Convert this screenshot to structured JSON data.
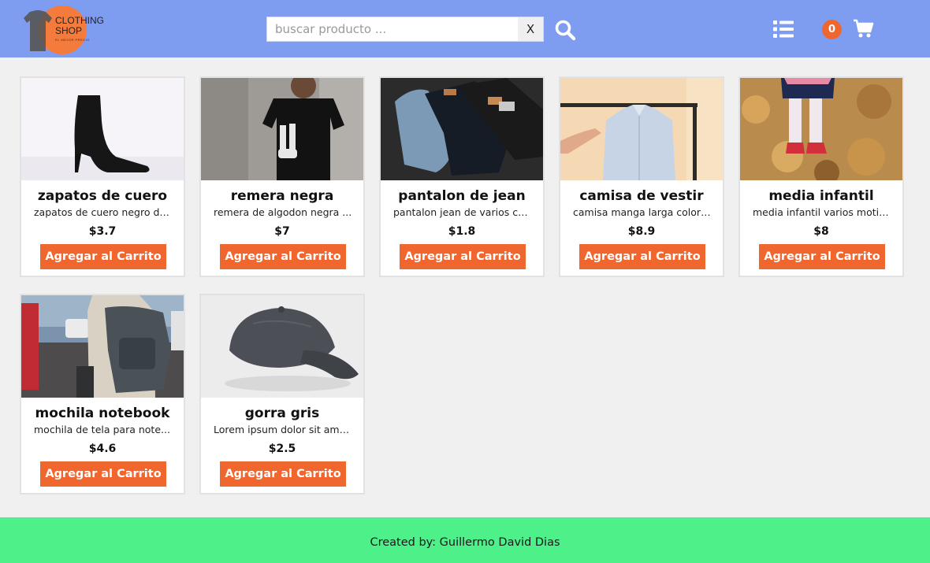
{
  "logo": {
    "line1": "CLOTHING",
    "line2": "SHOP",
    "tagline": "EL MEJOR PRECIO",
    "accent": "#f47b3b"
  },
  "search": {
    "placeholder": "buscar producto ...",
    "value": "",
    "clear_label": "X",
    "icon": "search-icon"
  },
  "nav": {
    "list_icon": "list-icon",
    "cart_icon": "cart-icon",
    "cart_count": "0"
  },
  "colors": {
    "header": "#7f9df0",
    "button": "#f0662f",
    "footer": "#4ef08a",
    "background": "#f0f0f0"
  },
  "products": [
    {
      "name": "zapatos de cuero",
      "desc": "zapatos de cuero negro de...",
      "price": "$3.7",
      "button": "Agregar al Carrito"
    },
    {
      "name": "remera negra",
      "desc": "remera de algodon negra ...",
      "price": "$7",
      "button": "Agregar al Carrito"
    },
    {
      "name": "pantalon de jean",
      "desc": "pantalon jean de varios col...",
      "price": "$1.8",
      "button": "Agregar al Carrito"
    },
    {
      "name": "camisa de vestir",
      "desc": "camisa manga larga color ...",
      "price": "$8.9",
      "button": "Agregar al Carrito"
    },
    {
      "name": "media infantil",
      "desc": "media infantil varios motiv...",
      "price": "$8",
      "button": "Agregar al Carrito"
    },
    {
      "name": "mochila notebook",
      "desc": "mochila de tela para note...",
      "price": "$4.6",
      "button": "Agregar al Carrito"
    },
    {
      "name": "gorra gris",
      "desc": "Lorem ipsum dolor sit ame...",
      "price": "$2.5",
      "button": "Agregar al Carrito"
    }
  ],
  "footer": {
    "text": "Created by: Guillermo David Dias"
  }
}
